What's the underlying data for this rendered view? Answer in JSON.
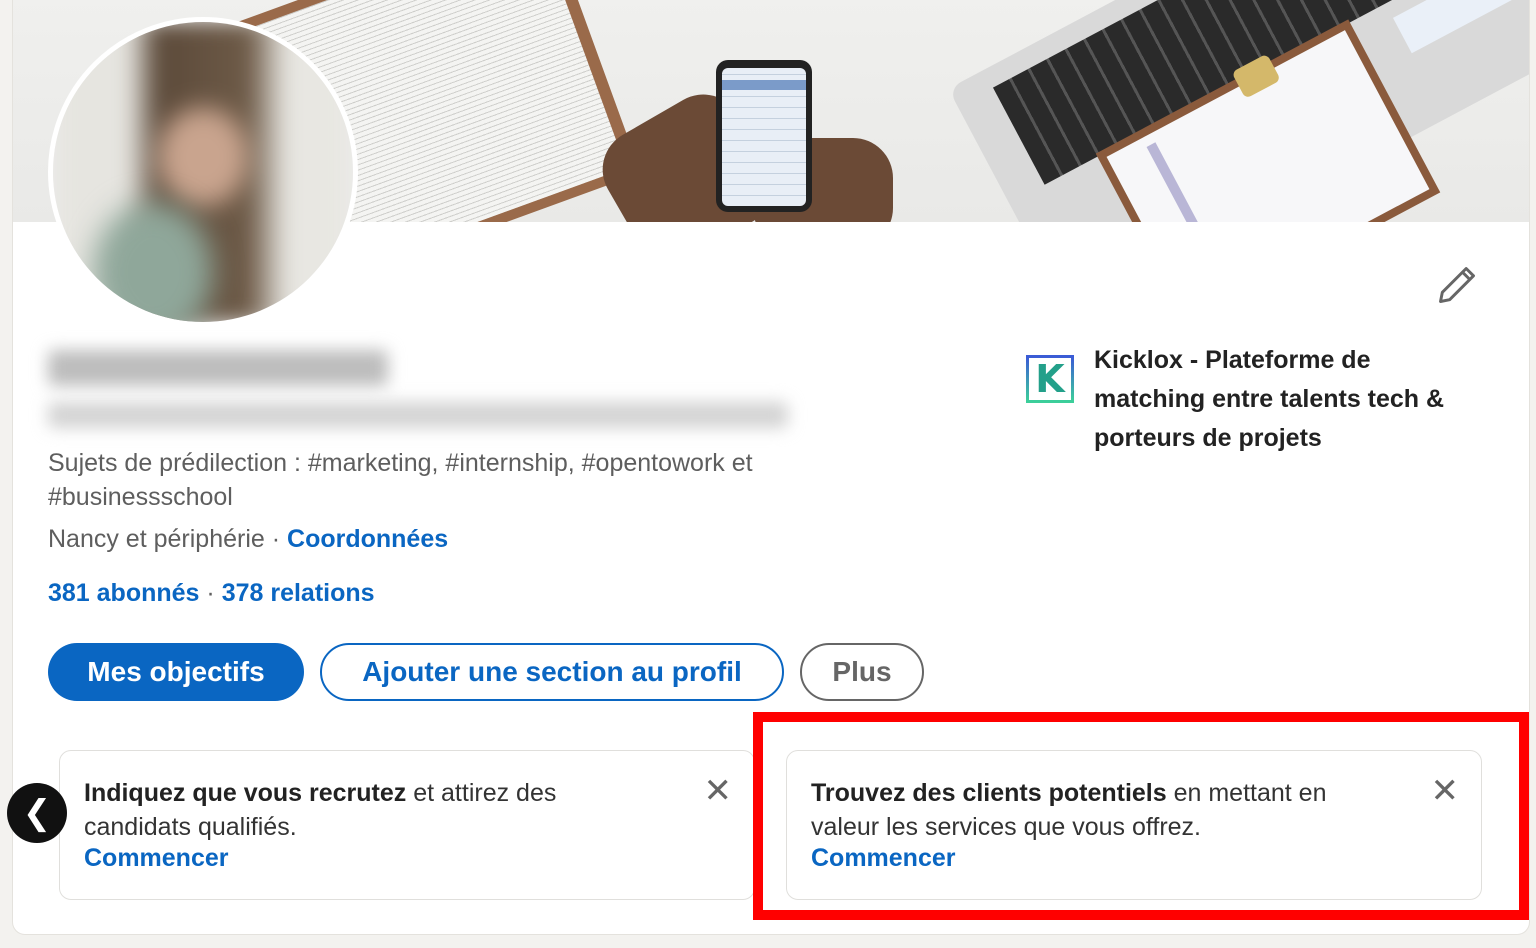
{
  "profile": {
    "name": "[blurred]",
    "headline": "[blurred]",
    "topics": "Sujets de prédilection : #marketing, #internship, #opentowork et #businessschool",
    "location": "Nancy et périphérie",
    "separator": " · ",
    "contact_link": "Coordonnées",
    "followers": "381 abonnés",
    "connections": "378 relations"
  },
  "company": {
    "logo_letter": "K",
    "name": "Kicklox - Plateforme de matching entre talents tech & porteurs de projets"
  },
  "actions": {
    "primary": "Mes objectifs",
    "add_section": "Ajouter une section au profil",
    "more": "Plus"
  },
  "icons": {
    "edit": "pencil-icon",
    "close": "close-icon",
    "prev": "chevron-left-icon",
    "close_glyph": "✕",
    "prev_glyph": "❮"
  },
  "promos": [
    {
      "bold": "Indiquez que vous recrutez",
      "rest": " et attirez des candidats qualifiés.",
      "cta": "Commencer"
    },
    {
      "bold": "Trouvez des clients potentiels",
      "rest": " en mettant en valeur les services que vous offrez.",
      "cta": "Commencer"
    }
  ],
  "colors": {
    "brand": "#0a66c2",
    "highlight": "#ff0000",
    "page_bg": "#f3f2ef"
  }
}
